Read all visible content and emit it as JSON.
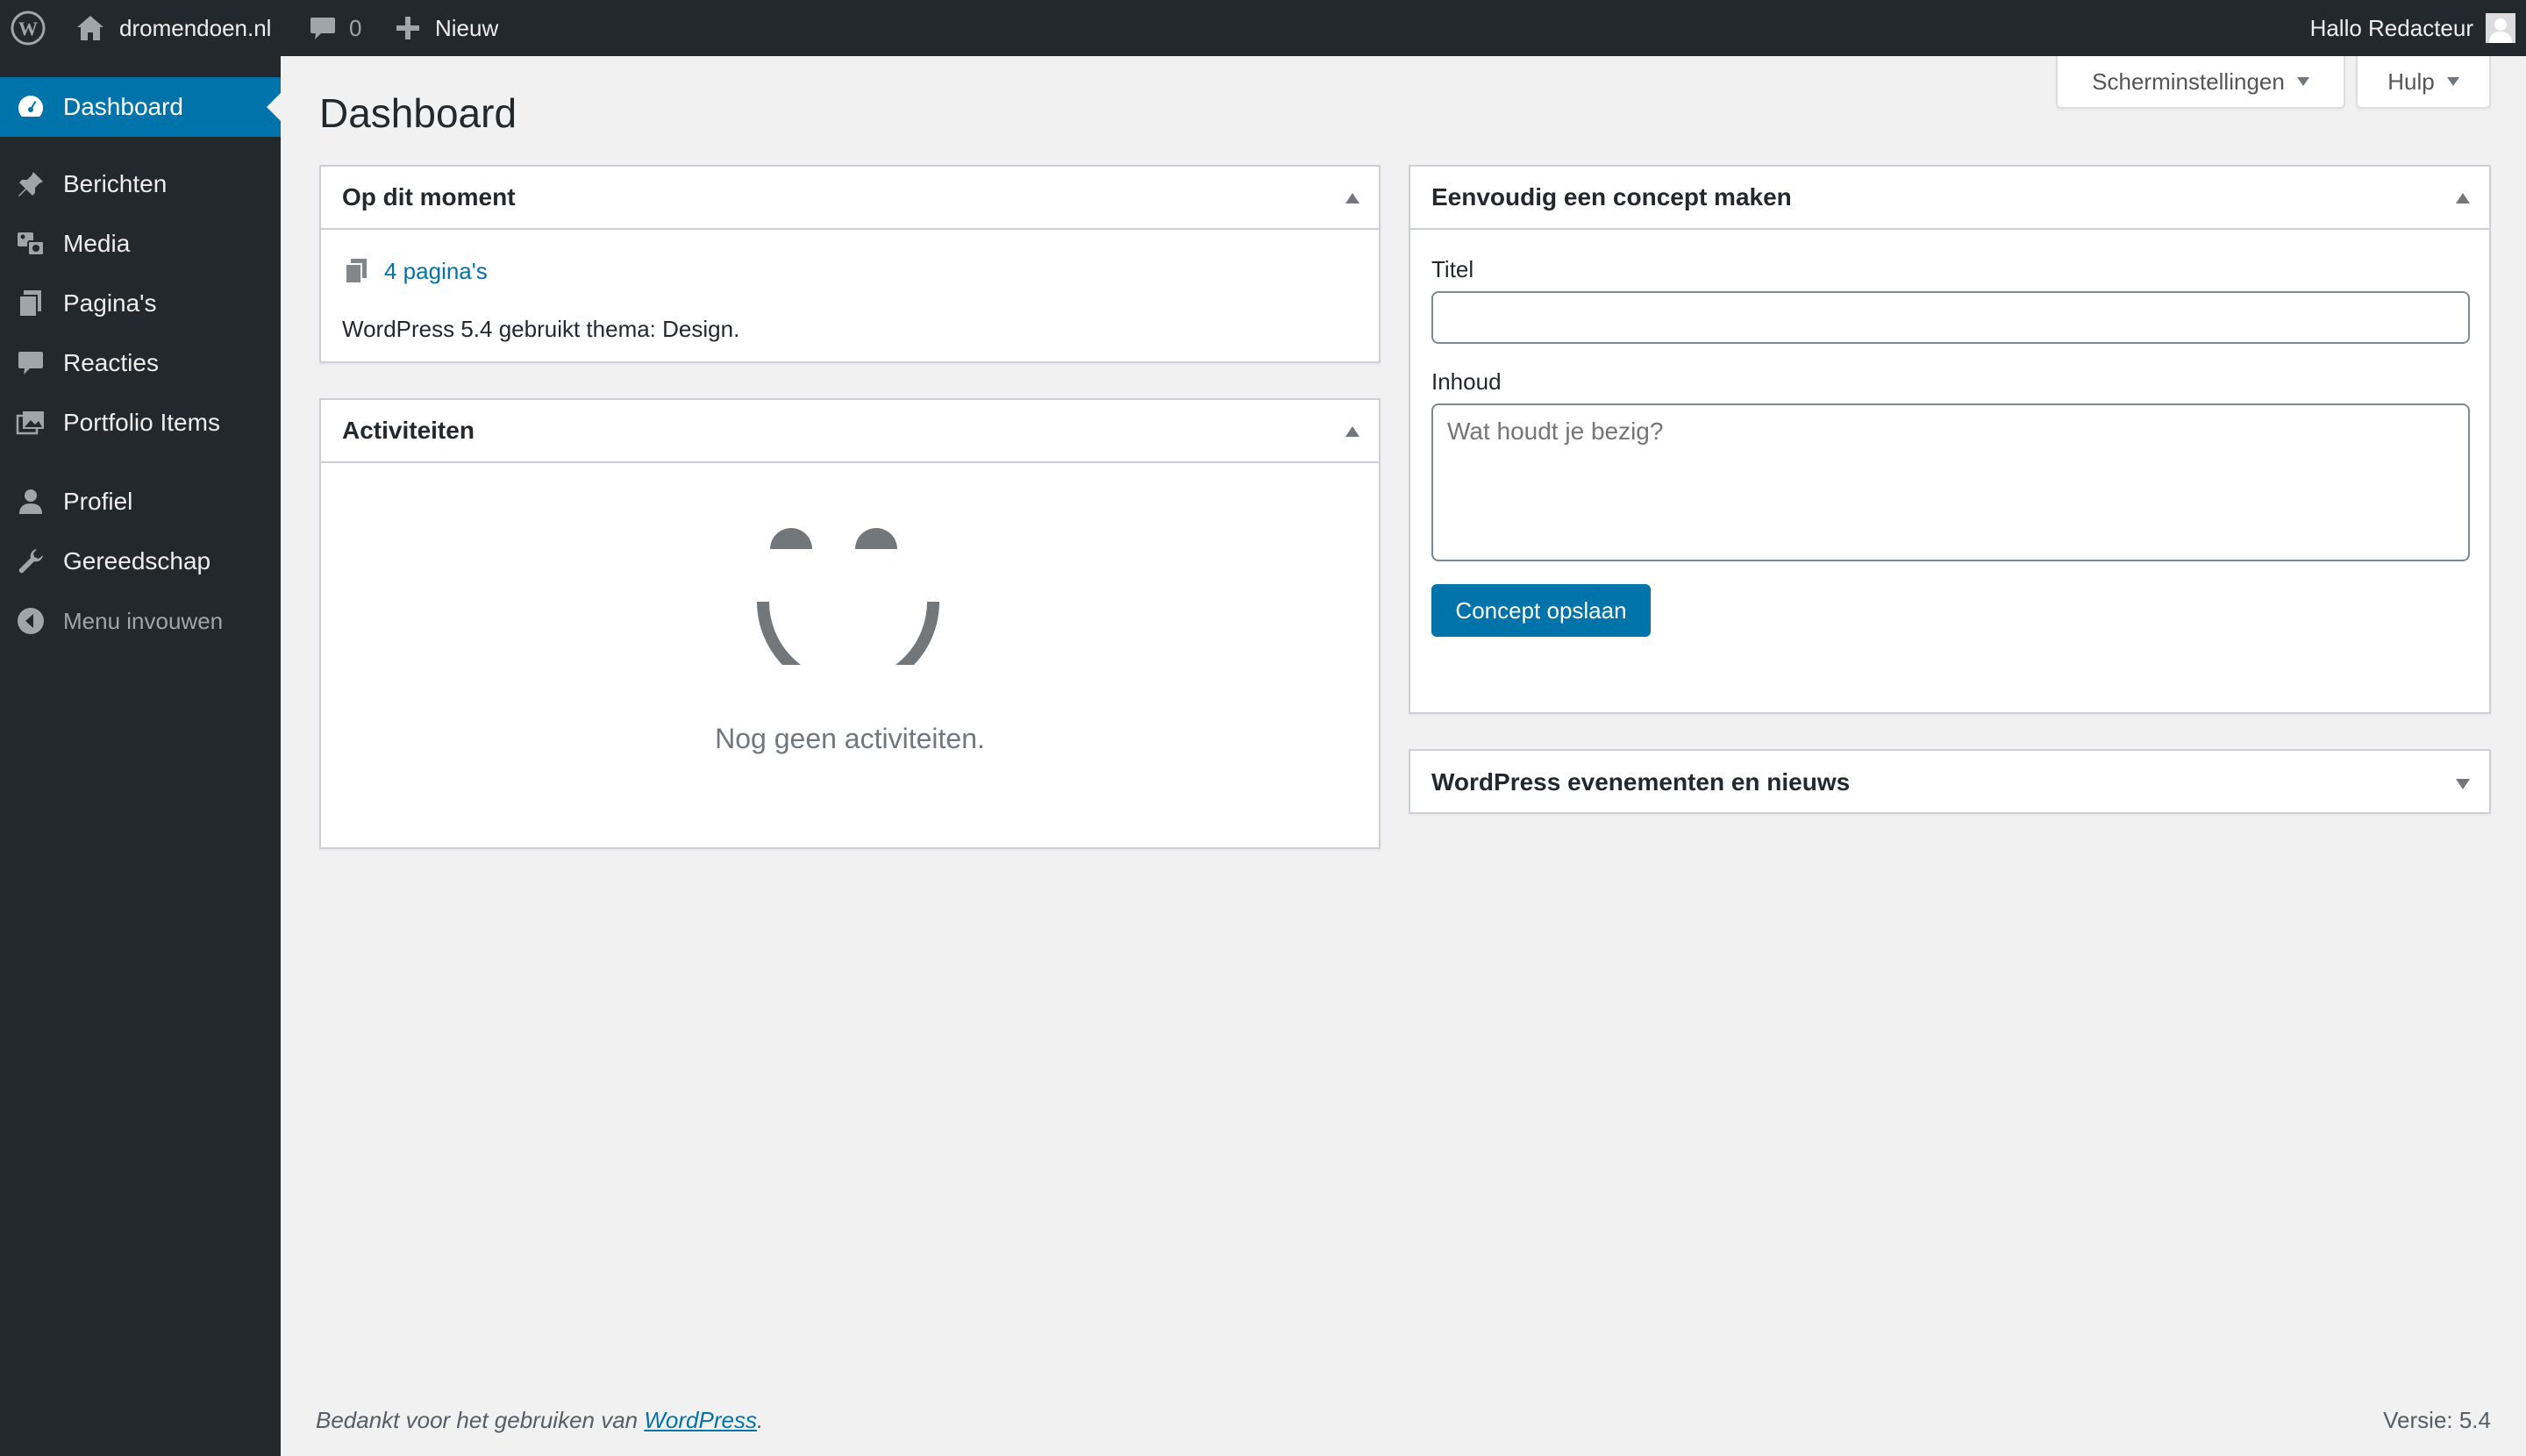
{
  "adminbar": {
    "site_name": "dromendoen.nl",
    "comments_count": "0",
    "new_label": "Nieuw",
    "greeting": "Hallo Redacteur",
    "icons": [
      "wordpress-logo-icon",
      "home-icon",
      "comment-icon",
      "plus-icon",
      "avatar"
    ]
  },
  "sidebar": {
    "items": [
      {
        "label": "Dashboard",
        "icon": "dashboard-icon",
        "current": true
      },
      {
        "label": "Berichten",
        "icon": "pin-icon"
      },
      {
        "label": "Media",
        "icon": "media-icon"
      },
      {
        "label": "Pagina's",
        "icon": "pages-icon"
      },
      {
        "label": "Reacties",
        "icon": "comments-icon"
      },
      {
        "label": "Portfolio Items",
        "icon": "portfolio-icon"
      },
      {
        "label": "Profiel",
        "icon": "user-icon"
      },
      {
        "label": "Gereedschap",
        "icon": "wrench-icon"
      },
      {
        "label": "Menu invouwen",
        "icon": "collapse-icon"
      }
    ]
  },
  "header": {
    "title": "Dashboard",
    "screen_options_label": "Scherminstellingen",
    "help_label": "Hulp"
  },
  "glance": {
    "title": "Op dit moment",
    "pages_link": "4 pagina's",
    "wp_info": "WordPress 5.4 gebruikt thema: Design."
  },
  "activity": {
    "title": "Activiteiten",
    "empty_text": "Nog geen activiteiten."
  },
  "quick_draft": {
    "title": "Eenvoudig een concept maken",
    "title_label": "Titel",
    "title_value": "",
    "content_label": "Inhoud",
    "content_placeholder": "Wat houdt je bezig?",
    "save_label": "Concept opslaan"
  },
  "events": {
    "title": "WordPress evenementen en nieuws"
  },
  "footer": {
    "thanks_prefix": "Bedankt voor het gebruiken van",
    "thanks_link": "WordPress",
    "thanks_suffix": ".",
    "version": "Versie: 5.4"
  },
  "colors": {
    "accent": "#0073aa",
    "sidebar_bg": "#23282d",
    "page_bg": "#f1f1f1"
  }
}
